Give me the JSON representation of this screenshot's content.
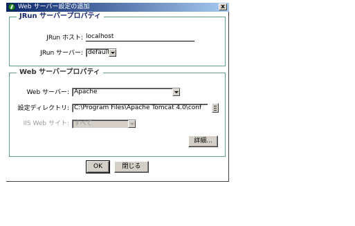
{
  "window": {
    "title": "Web サーバー設定の追加",
    "close_label": "x"
  },
  "jrun_group": {
    "title": "JRun サーバープロパティ",
    "host_label": "JRun ホスト:",
    "host_value": "localhost",
    "server_label": "JRun サーバー:",
    "server_value": "default"
  },
  "web_group": {
    "title": "Web サーバープロパティ",
    "webserver_label": "Web サーバー:",
    "webserver_value": "Apache",
    "config_dir_label": "設定ディレクトリ:",
    "config_dir_value": "C:\\Program Files\\Apache Tomcat 4.0\\conf",
    "iis_label": "IIS Web サイト:",
    "iis_value": "すべて",
    "details_button": "詳細..."
  },
  "footer": {
    "ok_button": "OK",
    "close_button": "閉じる"
  },
  "colors": {
    "group_border": "#5f9c8d",
    "title_blue": "#0a246a",
    "button_face": "#d4d0c8"
  }
}
